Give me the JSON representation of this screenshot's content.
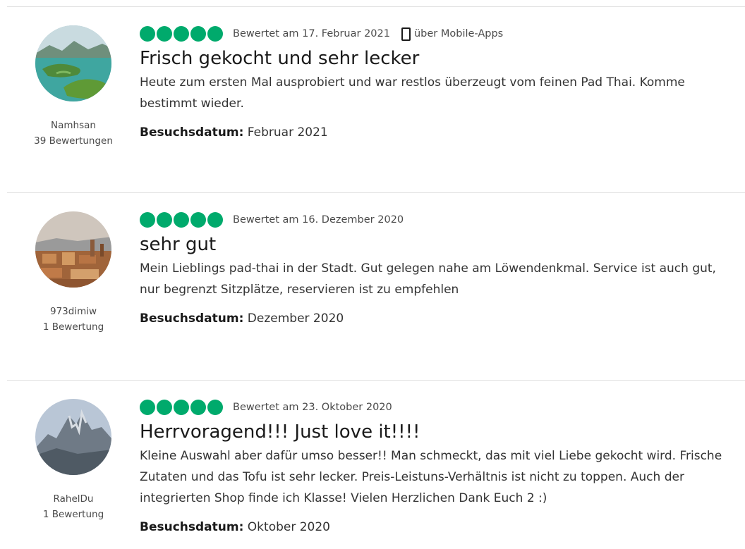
{
  "reviews": [
    {
      "username": "Namhsan",
      "contributions": "39 Bewertungen",
      "rating": 5,
      "date": "Bewertet am 17. Februar 2021",
      "via": "über Mobile-Apps",
      "title": "Frisch gekocht und sehr lecker",
      "body": "Heute zum ersten Mal ausprobiert und war restlos überzeugt vom feinen Pad Thai. Komme bestimmt wieder.",
      "visit_label": "Besuchsdatum:",
      "visit_date": "Februar 2021",
      "avatar_icon": "landscape-islands"
    },
    {
      "username": "973dimiw",
      "contributions": "1 Bewertung",
      "rating": 5,
      "date": "Bewertet am 16. Dezember 2020",
      "via": "",
      "title": "sehr gut",
      "body": "Mein Lieblings pad-thai in der Stadt. Gut gelegen nahe am Löwendenkmal. Service ist auch gut, nur begrenzt Sitzplätze, reservieren ist zu empfehlen",
      "visit_label": "Besuchsdatum:",
      "visit_date": "Dezember 2020",
      "avatar_icon": "old-town-rooftops"
    },
    {
      "username": "RahelDu",
      "contributions": "1 Bewertung",
      "rating": 5,
      "date": "Bewertet am 23. Oktober 2020",
      "via": "",
      "title": "Herrvoragend!!! Just love it!!!!",
      "body": "Kleine Auswahl aber dafür umso besser!! Man schmeckt, das mit viel Liebe gekocht wird. Frische Zutaten und das Tofu ist sehr lecker. Preis-Leistuns-Verhältnis ist nicht zu toppen. Auch der integrierten Shop finde ich Klasse! Vielen Herzlichen Dank Euch 2 :)",
      "visit_label": "Besuchsdatum:",
      "visit_date": "Oktober 2020",
      "avatar_icon": "mountain-peak"
    }
  ],
  "colors": {
    "bubble": "#00aa6c",
    "divider": "#e0e0e0"
  }
}
